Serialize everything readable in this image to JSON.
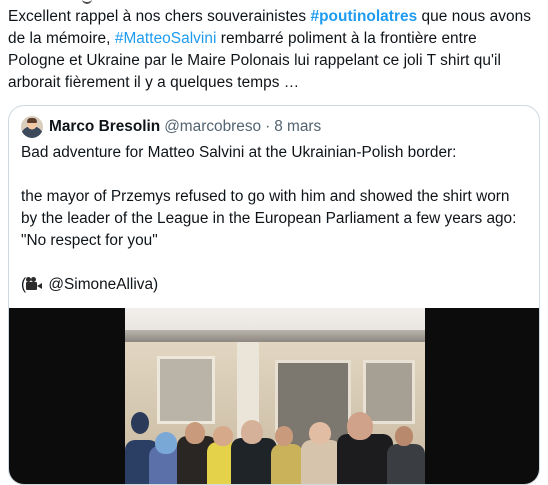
{
  "tweet": {
    "line1_a": "Excellent rappel à nos chers souverainistes ",
    "line1_hashtag": "#poutinolatres",
    "line1_b": " que nous avons",
    "line2_a": "de la mémoire, ",
    "line2_hashtag": "#MatteoSalvini",
    "line2_b": " rembarré poliment à la frontière entre",
    "line3": "Pologne et Ukraine par le Maire Polonais lui rappelant ce joli T shirt qu'il",
    "line4": "arborait fièrement il y a quelques temps …"
  },
  "quote": {
    "name": "Marco Bresolin",
    "handle": "@marcobreso",
    "separator": "·",
    "date": "8 mars",
    "body_line1": "Bad adventure for Matteo Salvini at the Ukrainian-Polish border:",
    "body_line2": "the mayor of Przemys refused to go with him and showed the shirt worn",
    "body_line3": "by the leader of the League in the European Parliament a few years ago:",
    "body_line4": "\"No respect for you\"",
    "credit_open": "(",
    "credit_handle": " @SimoneAlliva)"
  },
  "colors": {
    "hashtag": "#1d9bf0",
    "text": "#0f1419",
    "secondary": "#536471",
    "border": "#cfd9de"
  },
  "icons": {
    "avatar": "profile-photo",
    "credit_icon": "movie-camera-icon"
  }
}
